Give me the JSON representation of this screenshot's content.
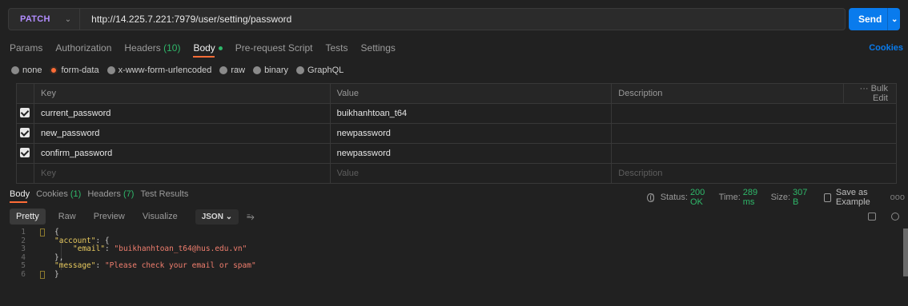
{
  "request": {
    "method": "PATCH",
    "url": "http://14.225.7.221:7979/user/setting/password",
    "send_label": "Send"
  },
  "request_tabs": {
    "params": "Params",
    "authorization": "Authorization",
    "headers": "Headers",
    "headers_count": "(10)",
    "body": "Body",
    "prerequest": "Pre-request Script",
    "tests": "Tests",
    "settings": "Settings",
    "cookies": "Cookies"
  },
  "body_types": [
    "none",
    "form-data",
    "x-www-form-urlencoded",
    "raw",
    "binary",
    "GraphQL"
  ],
  "body_type_selected": "form-data",
  "params_table": {
    "headers": [
      "Key",
      "Value",
      "Description"
    ],
    "bulk_edit": "Bulk Edit",
    "rows": [
      {
        "key": "current_password",
        "value": "buikhanhtoan_t64",
        "checked": true
      },
      {
        "key": "new_password",
        "value": "newpassword",
        "checked": true
      },
      {
        "key": "confirm_password",
        "value": "newpassword",
        "checked": true
      }
    ],
    "placeholders": {
      "key": "Key",
      "value": "Value",
      "description": "Description"
    }
  },
  "response_tabs": {
    "body": "Body",
    "cookies": "Cookies",
    "cookies_count": "(1)",
    "headers": "Headers",
    "headers_count": "(7)",
    "test_results": "Test Results"
  },
  "response_status": {
    "status_label": "Status:",
    "status_value": "200 OK",
    "time_label": "Time:",
    "time_value": "289 ms",
    "size_label": "Size:",
    "size_value": "307 B",
    "save_example": "Save as Example",
    "more": "ooo"
  },
  "response_toolbar": {
    "pretty": "Pretty",
    "raw": "Raw",
    "preview": "Preview",
    "visualize": "Visualize",
    "format": "JSON"
  },
  "code": {
    "line_numbers": [
      "1",
      "2",
      "3",
      "4",
      "5",
      "6"
    ],
    "l1": "{",
    "l2_key": "\"account\"",
    "l2_rest": ": {",
    "l3_key": "\"email\"",
    "l3_sep": ": ",
    "l3_val": "\"buikhanhtoan_t64@hus.edu.vn\"",
    "l4": "},",
    "l5_key": "\"message\"",
    "l5_sep": ": ",
    "l5_val": "\"Please check your email or spam\"",
    "l6": "}"
  },
  "colors": {
    "accent_orange": "#ff6c37",
    "send_blue": "#097bed",
    "method_purple": "#b28dff",
    "status_green": "#2fb86a"
  }
}
